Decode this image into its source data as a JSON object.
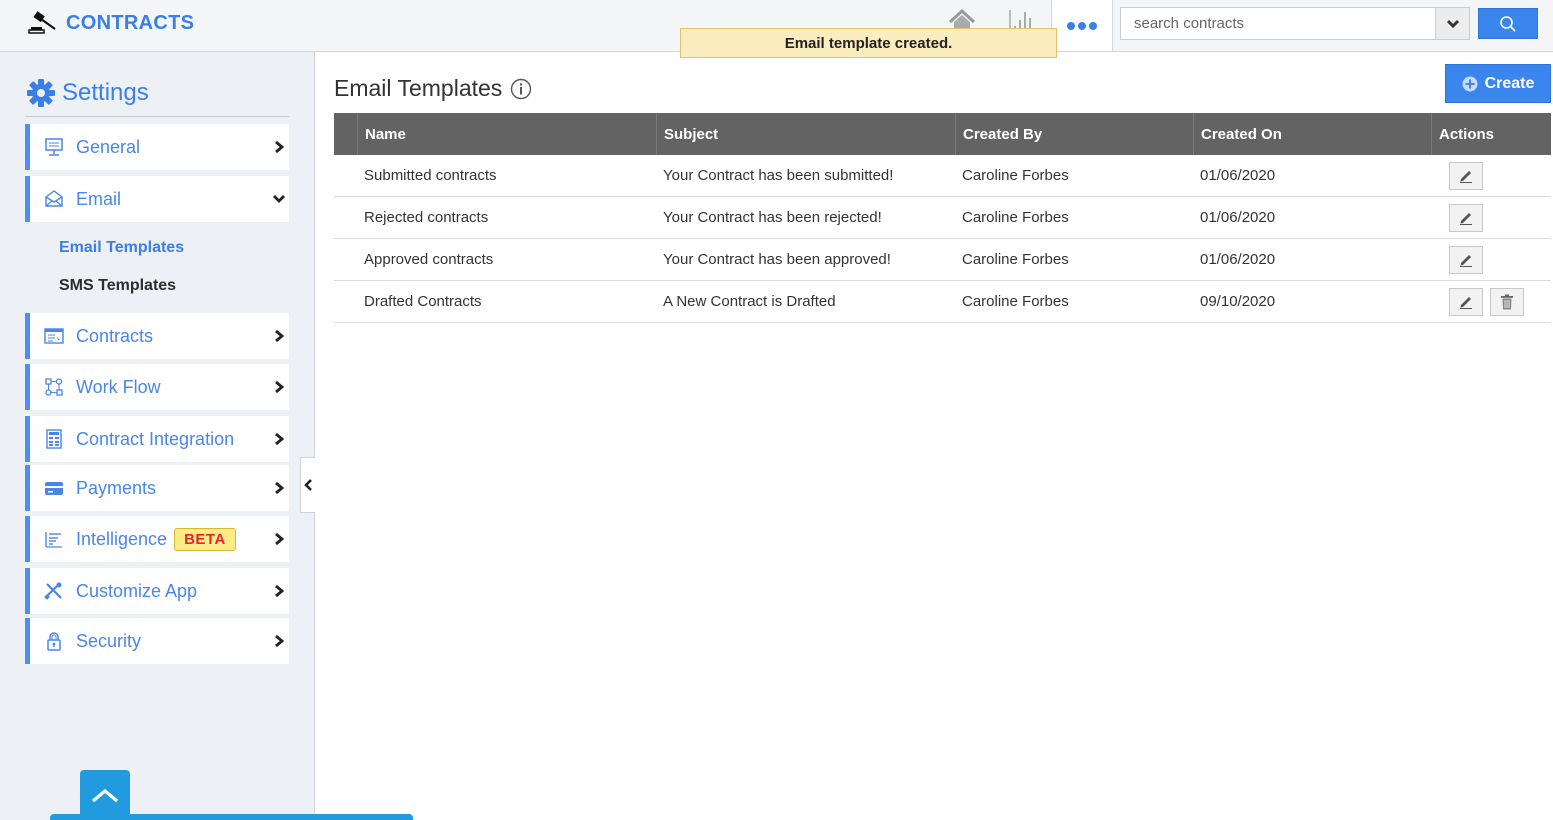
{
  "app": {
    "title": "CONTRACTS",
    "brand_color": "#3a7fe8"
  },
  "header": {
    "icons": [
      "gavel-icon",
      "home-icon",
      "bar-chart-icon",
      "more-icon"
    ],
    "search": {
      "placeholder": "search contracts",
      "value": ""
    }
  },
  "toast": {
    "message": "Email template created."
  },
  "sidebar": {
    "title": "Settings",
    "items": [
      {
        "label": "General",
        "icon": "monitor-icon",
        "state": "collapsed"
      },
      {
        "label": "Email",
        "icon": "envelope-icon",
        "state": "expanded"
      },
      {
        "label": "Contracts",
        "icon": "contract-window-icon",
        "state": "collapsed"
      },
      {
        "label": "Work Flow",
        "icon": "workflow-icon",
        "state": "collapsed"
      },
      {
        "label": "Contract Integration",
        "icon": "integration-icon",
        "state": "collapsed"
      },
      {
        "label": "Payments",
        "icon": "credit-card-icon",
        "state": "collapsed"
      },
      {
        "label": "Intelligence",
        "icon": "report-icon",
        "state": "collapsed",
        "badge": "BETA"
      },
      {
        "label": "Customize App",
        "icon": "tools-icon",
        "state": "collapsed"
      },
      {
        "label": "Security",
        "icon": "lock-icon",
        "state": "collapsed"
      }
    ],
    "email_subitems": [
      {
        "label": "Email Templates",
        "active": true
      },
      {
        "label": "SMS Templates",
        "active": false
      }
    ]
  },
  "main": {
    "title": "Email Templates",
    "create_label": "Create",
    "table": {
      "columns": [
        "Name",
        "Subject",
        "Created By",
        "Created On",
        "Actions"
      ],
      "rows": [
        {
          "name": "Submitted contracts",
          "subject": "Your Contract has been submitted!",
          "created_by": "Caroline Forbes",
          "created_on": "01/06/2020",
          "actions": [
            "edit"
          ]
        },
        {
          "name": "Rejected contracts",
          "subject": "Your Contract has been rejected!",
          "created_by": "Caroline Forbes",
          "created_on": "01/06/2020",
          "actions": [
            "edit"
          ]
        },
        {
          "name": "Approved contracts",
          "subject": "Your Contract has been approved!",
          "created_by": "Caroline Forbes",
          "created_on": "01/06/2020",
          "actions": [
            "edit"
          ]
        },
        {
          "name": "Drafted Contracts",
          "subject": "A New Contract is Drafted",
          "created_by": "Caroline Forbes",
          "created_on": "09/10/2020",
          "actions": [
            "edit",
            "delete"
          ]
        }
      ]
    }
  }
}
